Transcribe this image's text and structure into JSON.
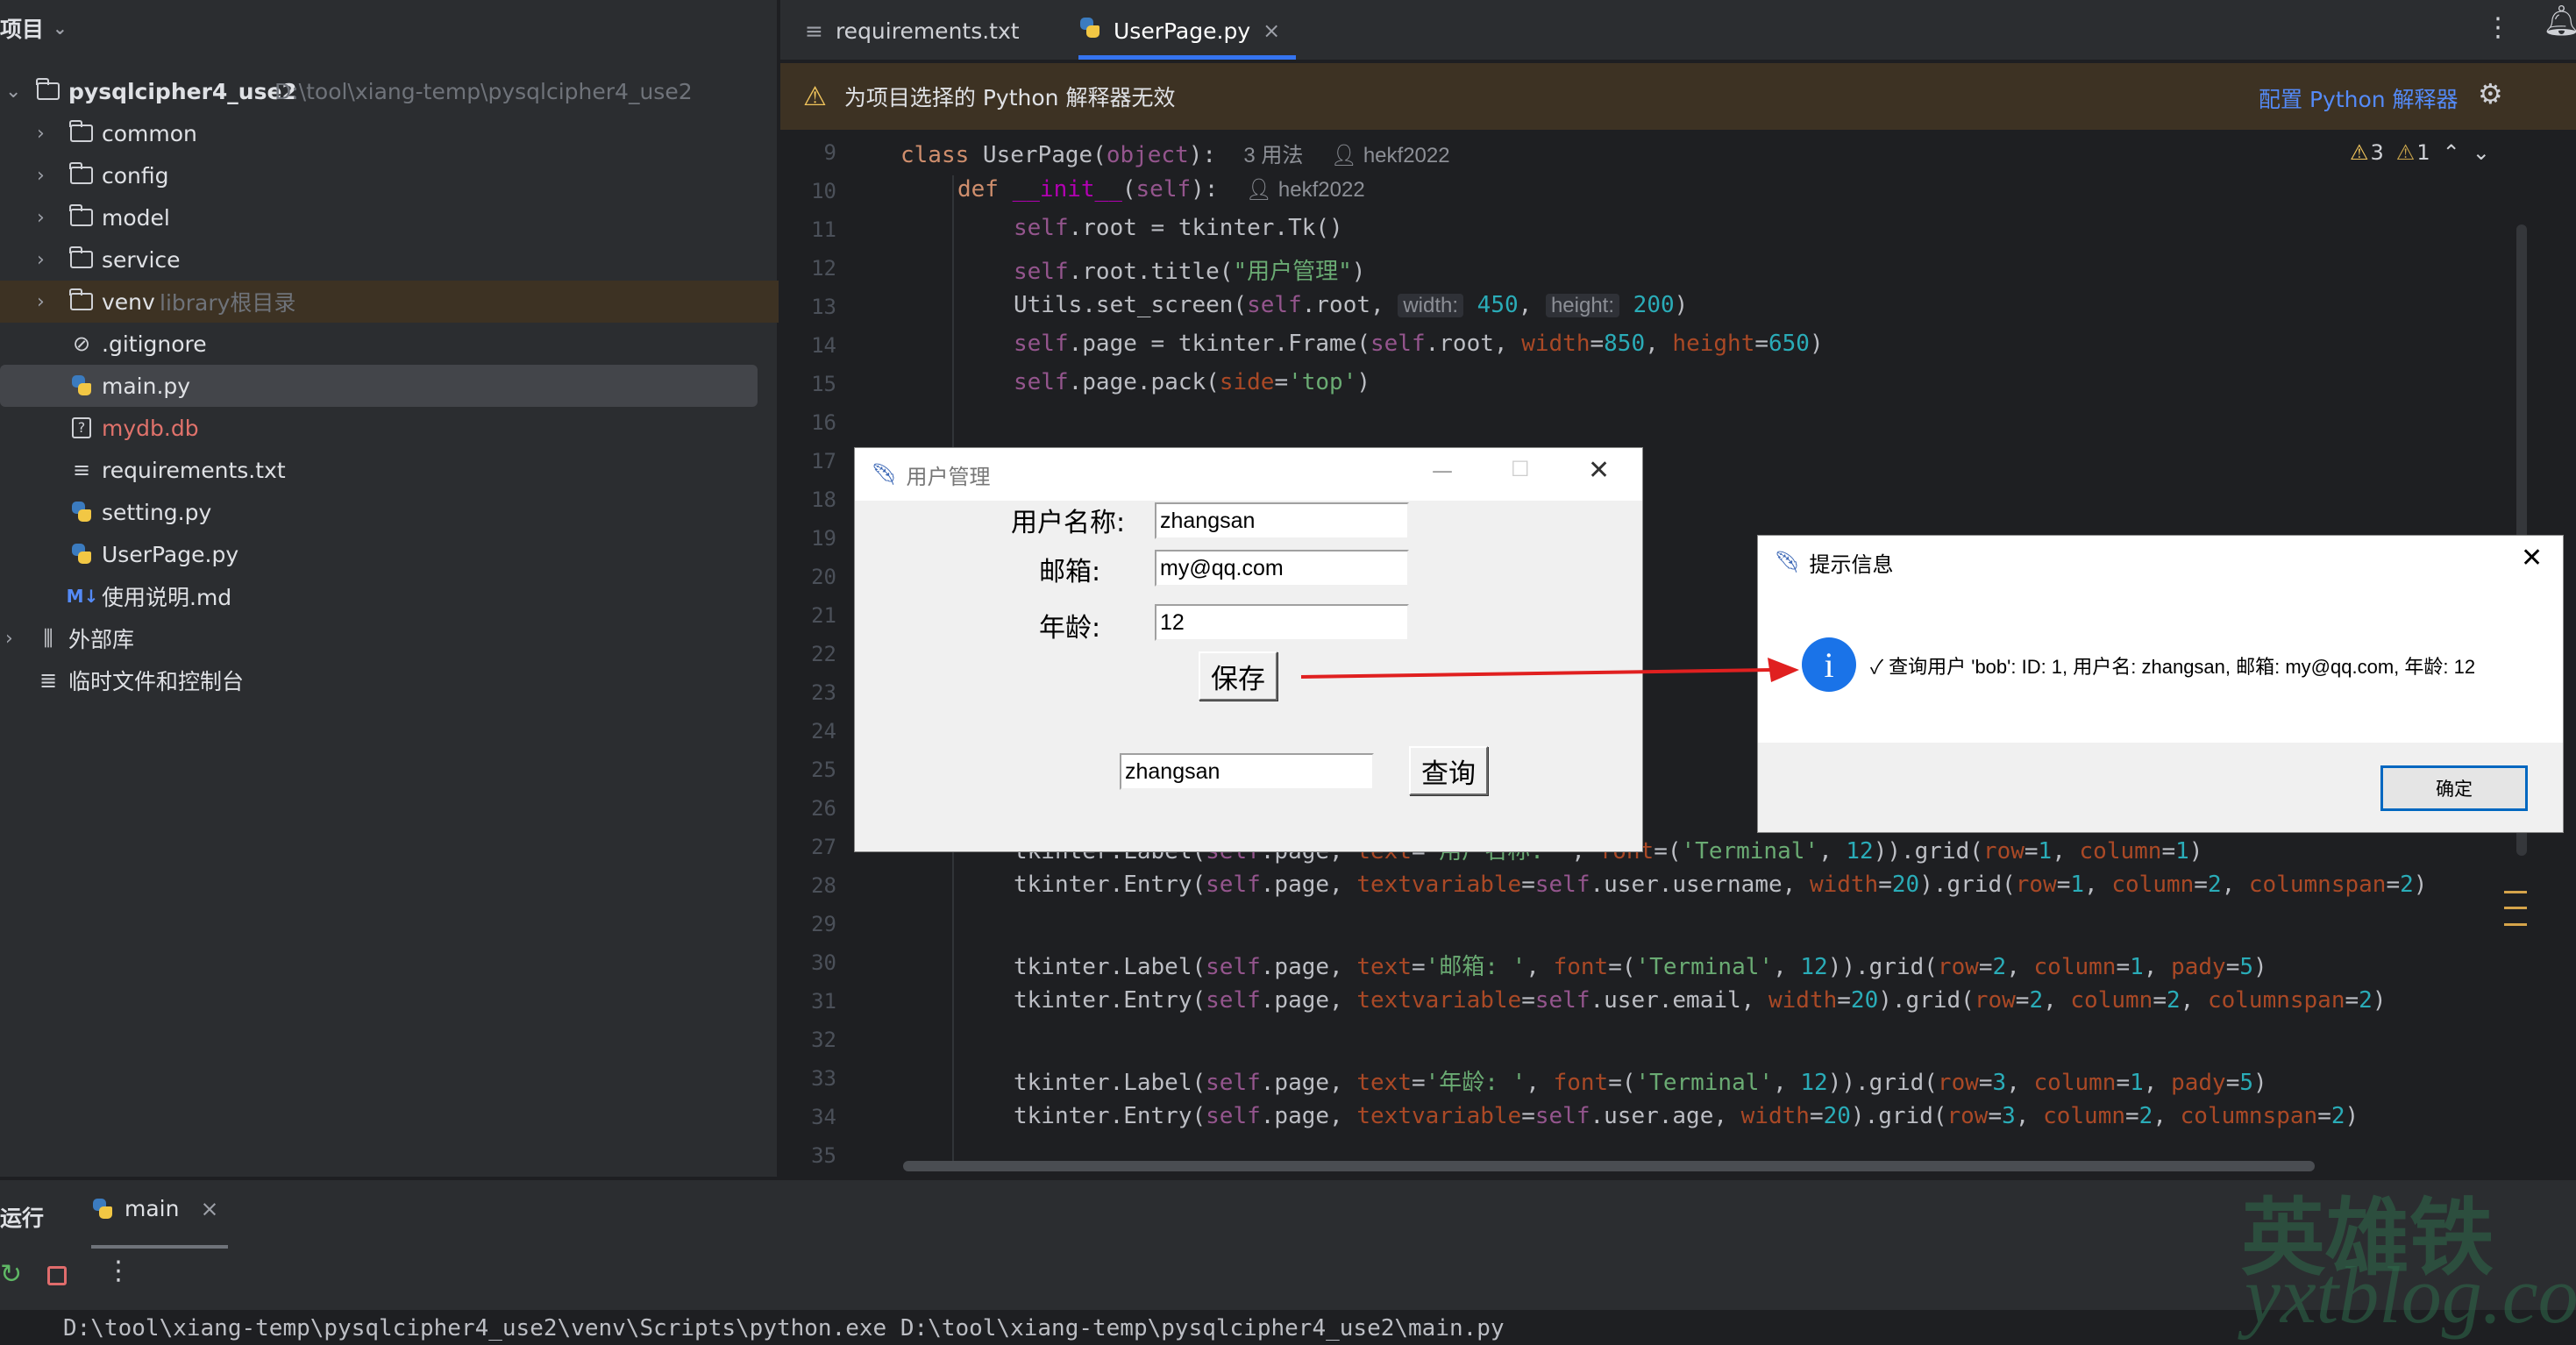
{
  "project_panel": {
    "header": "项目",
    "root_name": "pysqlcipher4_use2",
    "root_path": "D:\\tool\\xiang-temp\\pysqlcipher4_use2",
    "items": [
      {
        "label": "common",
        "type": "folder"
      },
      {
        "label": "config",
        "type": "folder"
      },
      {
        "label": "model",
        "type": "folder"
      },
      {
        "label": "service",
        "type": "folder"
      },
      {
        "label": "venv",
        "type": "folder",
        "note": "library根目录"
      },
      {
        "label": ".gitignore",
        "type": "ignore"
      },
      {
        "label": "main.py",
        "type": "python"
      },
      {
        "label": "mydb.db",
        "type": "db"
      },
      {
        "label": "requirements.txt",
        "type": "text"
      },
      {
        "label": "setting.py",
        "type": "python"
      },
      {
        "label": "UserPage.py",
        "type": "python"
      },
      {
        "label": "使用说明.md",
        "type": "markdown"
      },
      {
        "label": "外部库",
        "type": "library"
      },
      {
        "label": "临时文件和控制台",
        "type": "scratch"
      }
    ],
    "md_badge": "M↓"
  },
  "tabs": [
    {
      "label": "requirements.txt"
    },
    {
      "label": "UserPage.py",
      "close": "×"
    }
  ],
  "warning": {
    "text": "为项目选择的 Python 解释器无效",
    "link": "配置 Python 解释器"
  },
  "inspections": {
    "warnings": "3",
    "weak": "1"
  },
  "editor": {
    "line_numbers": [
      "9",
      "10",
      "11",
      "12",
      "13",
      "14",
      "15",
      "16",
      "17",
      "18",
      "19",
      "20",
      "21",
      "22",
      "23",
      "24",
      "25",
      "26",
      "27",
      "28",
      "29",
      "30",
      "31",
      "32",
      "33",
      "34",
      "35"
    ],
    "class_hint": "3 用法",
    "author": "hekf2022",
    "author2": "hekf2022",
    "hint_width": "width:",
    "hint_height": "height:"
  },
  "user_window": {
    "title": "用户管理",
    "username_label": "用户名称:",
    "email_label": "邮箱:",
    "age_label": "年龄:",
    "username_value": "zhangsan",
    "email_value": "my@qq.com",
    "age_value": "12",
    "save_label": "保存",
    "query_value": "zhangsan",
    "query_label": "查询"
  },
  "info_dialog": {
    "title": "提示信息",
    "message": "✓ 查询用户 'bob': ID: 1, 用户名: zhangsan, 邮箱: my@qq.com, 年龄: 12",
    "ok_label": "确定"
  },
  "run_panel": {
    "label": "运行",
    "tab": "main",
    "tab_close": "×",
    "console_line": "D:\\tool\\xiang-temp\\pysqlcipher4_use2\\venv\\Scripts\\python.exe D:\\tool\\xiang-temp\\pysqlcipher4_use2\\main.py"
  },
  "watermark": {
    "brand": "英雄铁",
    "site": "yxtblog.com"
  },
  "colors": {
    "accent": "#3574f0",
    "warning_bg": "#3d3223",
    "arrow": "#e02020"
  }
}
